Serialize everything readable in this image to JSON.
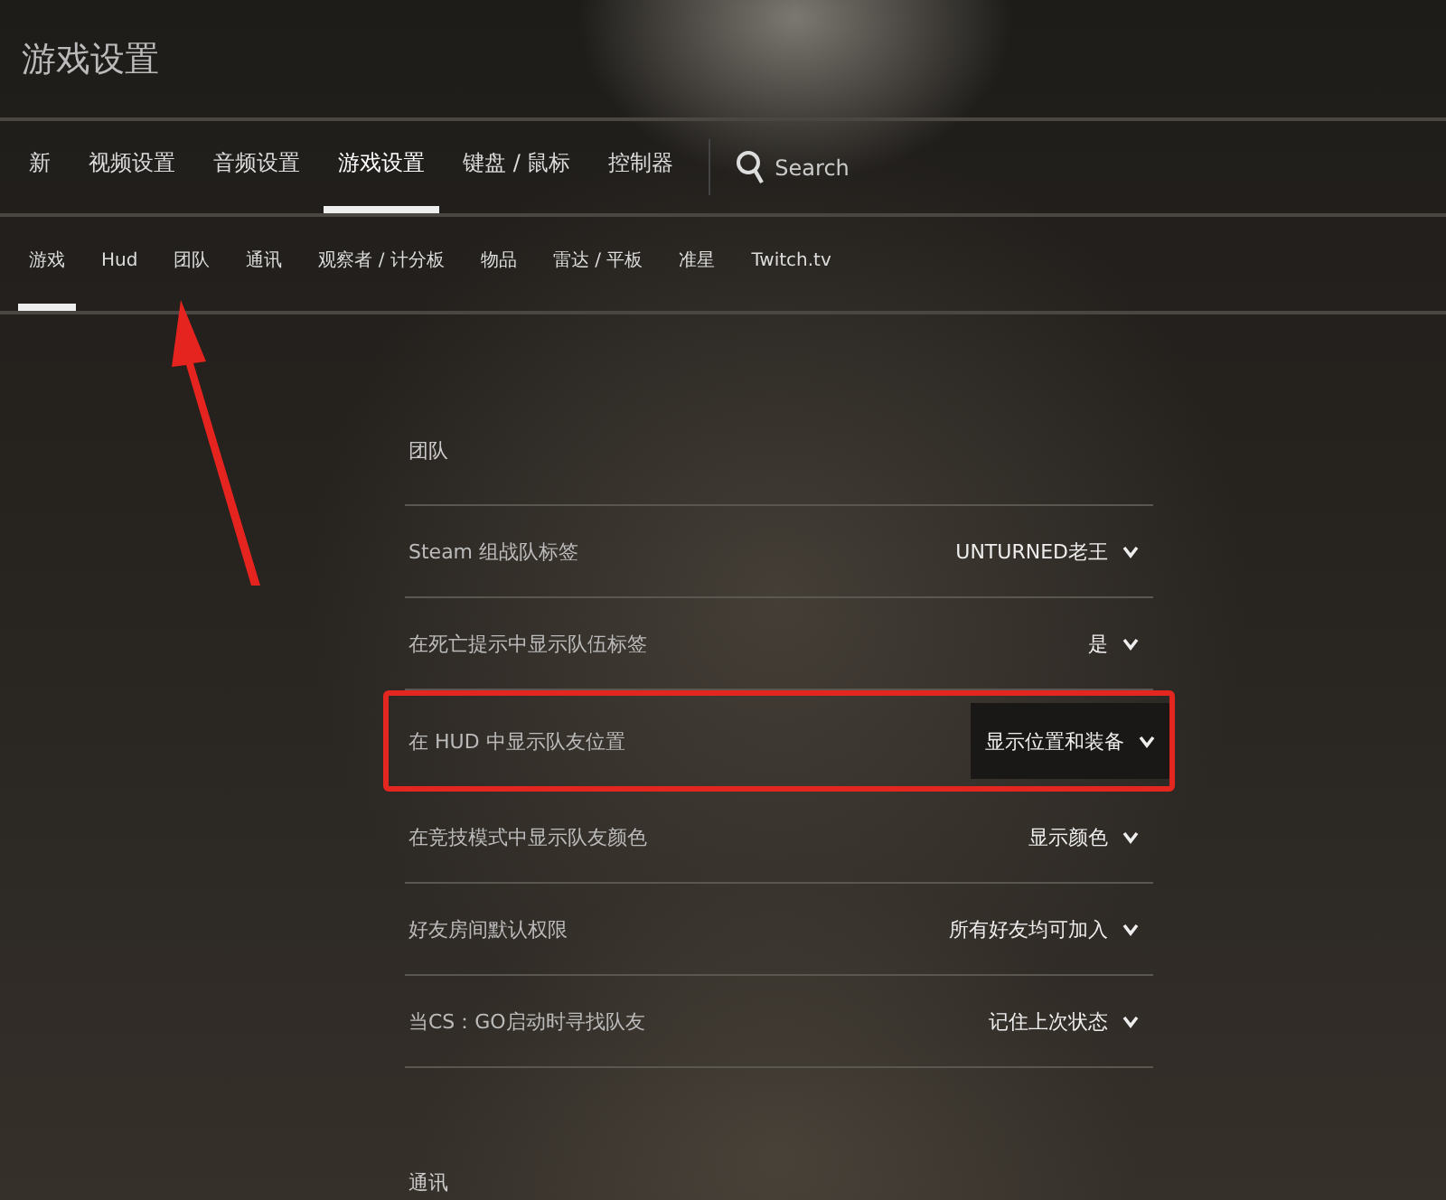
{
  "window": {
    "title": "游戏设置"
  },
  "tabs": [
    {
      "label": "新",
      "selected": false
    },
    {
      "label": "视频设置",
      "selected": false
    },
    {
      "label": "音频设置",
      "selected": false
    },
    {
      "label": "游戏设置",
      "selected": true
    },
    {
      "label": "键盘 / 鼠标",
      "selected": false
    },
    {
      "label": "控制器",
      "selected": false
    }
  ],
  "search": {
    "placeholder": "Search"
  },
  "subtabs": [
    {
      "label": "游戏",
      "selected": true
    },
    {
      "label": "Hud",
      "selected": false
    },
    {
      "label": "团队",
      "selected": false
    },
    {
      "label": "通讯",
      "selected": false
    },
    {
      "label": "观察者 / 计分板",
      "selected": false
    },
    {
      "label": "物品",
      "selected": false
    },
    {
      "label": "雷达 / 平板",
      "selected": false
    },
    {
      "label": "准星",
      "selected": false
    },
    {
      "label": "Twitch.tv",
      "selected": false
    }
  ],
  "section": {
    "heading": "团队"
  },
  "settings": [
    {
      "label": "Steam 组战队标签",
      "value": "UNTURNED老王",
      "highlighted": false
    },
    {
      "label": "在死亡提示中显示队伍标签",
      "value": "是",
      "highlighted": false
    },
    {
      "label": "在 HUD 中显示队友位置",
      "value": "显示位置和装备",
      "highlighted": true
    },
    {
      "label": "在竞技模式中显示队友颜色",
      "value": "显示颜色",
      "highlighted": false
    },
    {
      "label": "好友房间默认权限",
      "value": "所有好友均可加入",
      "highlighted": false
    },
    {
      "label": "当CS：GO启动时寻找队友",
      "value": "记住上次状态",
      "highlighted": false
    }
  ],
  "next_section": {
    "heading": "通讯"
  }
}
